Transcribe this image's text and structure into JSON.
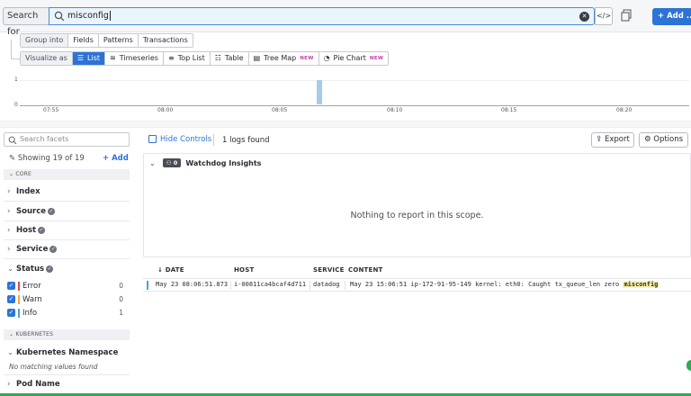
{
  "search": {
    "label": "Search for",
    "query": "misconfig",
    "code_label": "</>",
    "add_label": "+ Add ..."
  },
  "group_into": {
    "label": "Group into",
    "options": [
      "Fields",
      "Patterns",
      "Transactions"
    ]
  },
  "visualize_as": {
    "label": "Visualize as",
    "options": [
      {
        "label": "List",
        "active": true,
        "icon": "list-icon",
        "badge": ""
      },
      {
        "label": "Timeseries",
        "active": false,
        "icon": "timeseries-icon",
        "badge": ""
      },
      {
        "label": "Top List",
        "active": false,
        "icon": "toplist-icon",
        "badge": ""
      },
      {
        "label": "Table",
        "active": false,
        "icon": "table-icon",
        "badge": ""
      },
      {
        "label": "Tree Map",
        "active": false,
        "icon": "treemap-icon",
        "badge": "NEW"
      },
      {
        "label": "Pie Chart",
        "active": false,
        "icon": "piechart-icon",
        "badge": "NEW"
      }
    ]
  },
  "timeline": {
    "y_ticks": [
      "1",
      "0"
    ],
    "x_ticks": [
      "07:55",
      "08:00",
      "08:05",
      "08:10",
      "08:15",
      "08:20"
    ],
    "bar_time": "08:06",
    "bar_value": 1
  },
  "facets": {
    "search_placeholder": "Search facets",
    "showing": "Showing 19 of 19",
    "add_label": "Add",
    "core_header": "CORE",
    "items": [
      "Index",
      "Source",
      "Host",
      "Service"
    ],
    "status_label": "Status",
    "status_values": [
      {
        "label": "Error",
        "count": "0",
        "color": "#e0454c"
      },
      {
        "label": "Warn",
        "count": "0",
        "color": "#f0a73a"
      },
      {
        "label": "Info",
        "count": "1",
        "color": "#4a9ee0"
      }
    ],
    "kubernetes_header": "KUBERNETES",
    "k8s_namespace": "Kubernetes Namespace",
    "no_match": "No matching values found",
    "pod_name": "Pod Name"
  },
  "main": {
    "hide_controls": "Hide Controls",
    "logs_found": "1 logs found",
    "export": "Export",
    "options": "Options",
    "insights_badge": "0",
    "insights_title": "Watchdog Insights",
    "nothing": "Nothing to report in this scope."
  },
  "logs": {
    "columns": [
      "DATE",
      "HOST",
      "SERVICE",
      "CONTENT"
    ],
    "rows": [
      {
        "date": "May 23 08:06:51.873",
        "host": "i-00811ca4bcaf4d711",
        "service": "datadog",
        "content": "May 23 15:06:51 ip-172-91-95-149 kernel: eth0: Caught tx_queue_len zero",
        "highlight": "misconfig"
      }
    ]
  }
}
